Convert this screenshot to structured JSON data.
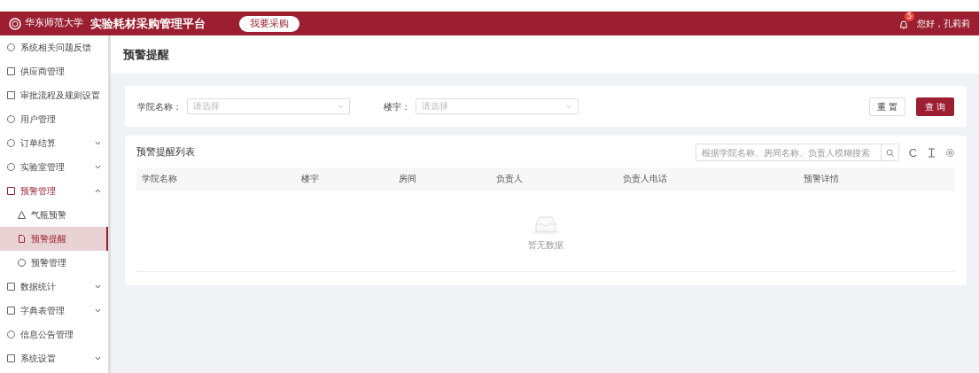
{
  "header": {
    "logo_text": "华东师范大学",
    "title": "实验耗材采购管理平台",
    "purchase_button": "我要采购",
    "notification_count": "5",
    "greeting": "您好，孔莉莉"
  },
  "sidebar": {
    "items": [
      {
        "label": "系统相关问题反馈",
        "kind": "link",
        "selected": false
      },
      {
        "label": "供应商管理",
        "kind": "link",
        "selected": false
      },
      {
        "label": "审批流程及规则设置",
        "kind": "link",
        "selected": false
      },
      {
        "label": "用户管理",
        "kind": "link",
        "selected": false
      },
      {
        "label": "订单结算",
        "kind": "group",
        "expanded": false,
        "selected": false
      },
      {
        "label": "实验室管理",
        "kind": "group",
        "expanded": false,
        "selected": false
      },
      {
        "label": "预警管理",
        "kind": "group",
        "expanded": true,
        "selected": true,
        "children": [
          {
            "label": "气瓶预警",
            "selected": false
          },
          {
            "label": "预警提醒",
            "selected": true
          },
          {
            "label": "预警管理",
            "selected": false
          }
        ]
      },
      {
        "label": "数据统计",
        "kind": "group",
        "expanded": false,
        "selected": false
      },
      {
        "label": "字典表管理",
        "kind": "group",
        "expanded": false,
        "selected": false
      },
      {
        "label": "信息公告管理",
        "kind": "link",
        "selected": false
      },
      {
        "label": "系统设置",
        "kind": "group",
        "expanded": false,
        "selected": false
      }
    ]
  },
  "page_title": "预警提醒",
  "filters": [
    {
      "label": "学院名称：",
      "placeholder": "请选择"
    },
    {
      "label": "楼宇：",
      "placeholder": "请选择"
    }
  ],
  "filter_buttons": {
    "reset": "重 置",
    "query": "查 询"
  },
  "list": {
    "title": "预警提醒列表",
    "search_placeholder": "根据学院名称、房间名称、负责人模糊搜索",
    "columns": [
      "学院名称",
      "楼宇",
      "房间",
      "负责人",
      "负责人电话",
      "预警详情"
    ],
    "empty_text": "暂无数据"
  }
}
